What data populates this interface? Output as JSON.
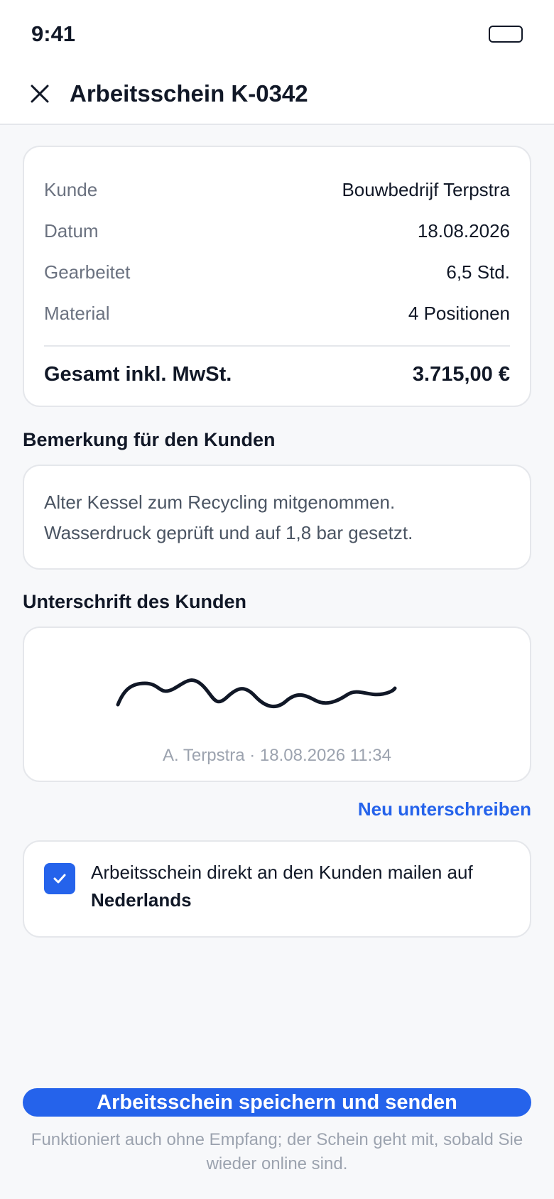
{
  "status_bar": {
    "time": "9:41"
  },
  "header": {
    "title": "Arbeitsschein K-0342"
  },
  "summary": {
    "rows": [
      {
        "label": "Kunde",
        "value": "Bouwbedrijf Terpstra"
      },
      {
        "label": "Datum",
        "value": "18.08.2026"
      },
      {
        "label": "Gearbeitet",
        "value": "6,5 Std."
      },
      {
        "label": "Material",
        "value": "4 Positionen"
      }
    ],
    "total": {
      "label": "Gesamt inkl. MwSt.",
      "value": "3.715,00 €"
    }
  },
  "note": {
    "label": "Bemerkung für den Kunden",
    "lines": [
      "Alter Kessel zum Recycling mitgenommen.",
      "Wasserdruck geprüft und auf 1,8 bar gesetzt."
    ]
  },
  "signature": {
    "label": "Unterschrift des Kunden",
    "caption": "A. Terpstra · 18.08.2026 11:34",
    "resign_label": "Neu unterschreiben"
  },
  "mail_option": {
    "checked": true,
    "text": "Arbeitsschein direkt an den Kunden mailen auf",
    "language": "Nederlands"
  },
  "actions": {
    "primary_label": "Arbeitsschein speichern und senden",
    "footnote": "Funktioniert auch ohne Empfang; der Schein geht mit, sobald Sie wieder online sind."
  },
  "colors": {
    "accent": "#2563eb",
    "background": "#f7f8fa",
    "card": "#ffffff",
    "text": "#111827",
    "muted": "#6b7280"
  },
  "icons": {
    "close": "close-icon",
    "check": "check-icon",
    "battery": "battery-icon"
  }
}
